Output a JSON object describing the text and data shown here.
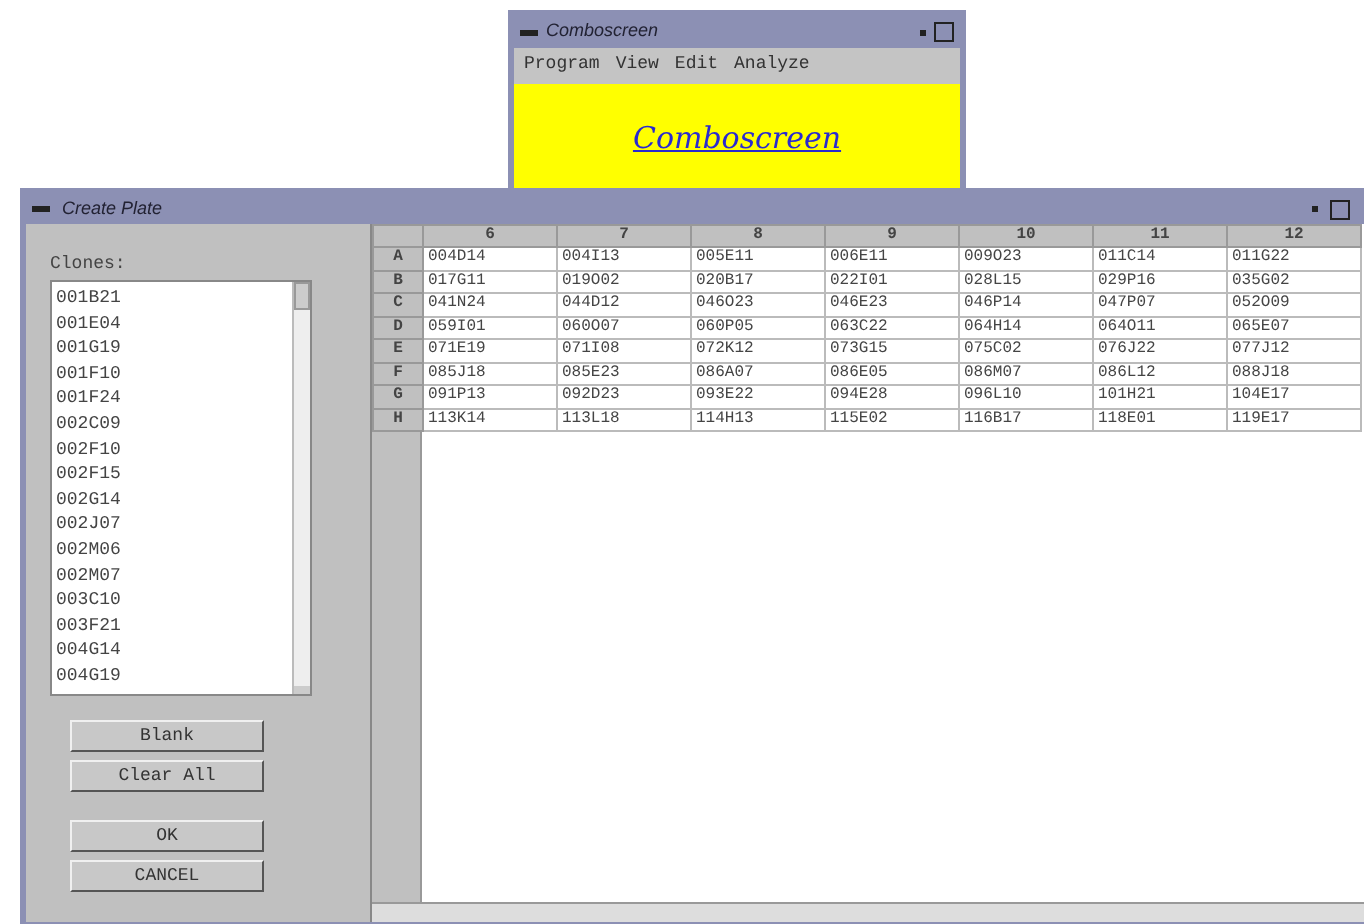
{
  "back_window": {
    "title": "Comboscreen",
    "menu": [
      "Program",
      "View",
      "Edit",
      "Analyze"
    ],
    "banner": "Comboscreen"
  },
  "dialog": {
    "title": "Create Plate",
    "clones_label": "Clones:",
    "clones": [
      "001B21",
      "001E04",
      "001G19",
      "001F10",
      "001F24",
      "002C09",
      "002F10",
      "002F15",
      "002G14",
      "002J07",
      "002M06",
      "002M07",
      "003C10",
      "003F21",
      "004G14",
      "004G19"
    ],
    "buttons": [
      "Blank",
      "Clear All",
      "OK",
      "CANCEL"
    ],
    "table": {
      "columns": [
        "6",
        "7",
        "8",
        "9",
        "10",
        "11",
        "12"
      ],
      "rows": [
        {
          "label": "A",
          "cells": [
            "004D14",
            "004I13",
            "005E11",
            "006E11",
            "009O23",
            "011C14",
            "011G22"
          ]
        },
        {
          "label": "B",
          "cells": [
            "017G11",
            "019O02",
            "020B17",
            "022I01",
            "028L15",
            "029P16",
            "035G02"
          ]
        },
        {
          "label": "C",
          "cells": [
            "041N24",
            "044D12",
            "046O23",
            "046E23",
            "046P14",
            "047P07",
            "052O09"
          ]
        },
        {
          "label": "D",
          "cells": [
            "059I01",
            "060O07",
            "060P05",
            "063C22",
            "064H14",
            "064O11",
            "065E07"
          ]
        },
        {
          "label": "E",
          "cells": [
            "071E19",
            "071I08",
            "072K12",
            "073G15",
            "075C02",
            "076J22",
            "077J12"
          ]
        },
        {
          "label": "F",
          "cells": [
            "085J18",
            "085E23",
            "086A07",
            "086E05",
            "086M07",
            "086L12",
            "088J18"
          ]
        },
        {
          "label": "G",
          "cells": [
            "091P13",
            "092D23",
            "093E22",
            "094E28",
            "096L10",
            "101H21",
            "104E17"
          ]
        },
        {
          "label": "H",
          "cells": [
            "113K14",
            "113L18",
            "114H13",
            "115E02",
            "116B17",
            "118E01",
            "119E17"
          ]
        }
      ]
    }
  }
}
